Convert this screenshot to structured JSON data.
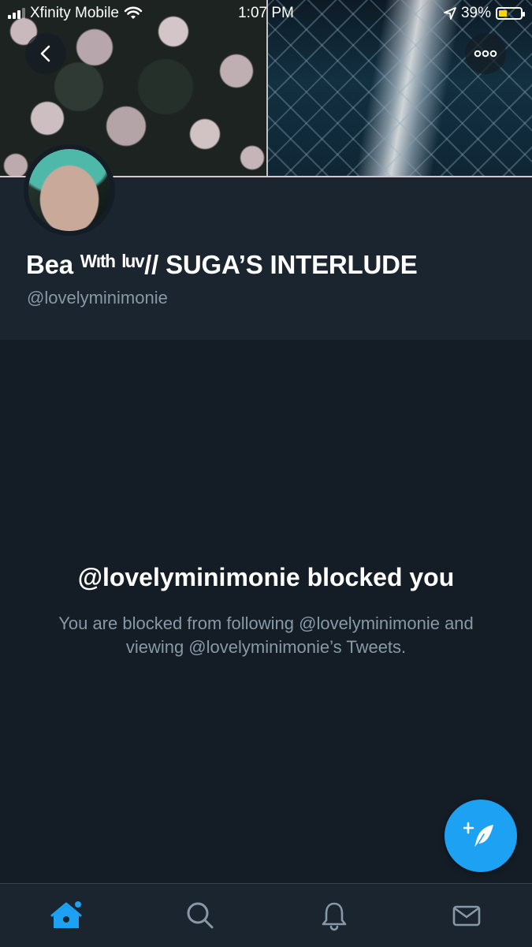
{
  "status_bar": {
    "carrier": "Xfinity Mobile",
    "time": "1:07 PM",
    "battery": "39%",
    "battery_level": 0.39
  },
  "profile": {
    "display_name": "Bea ᵂᶦᵗʰ ˡᵘᵛ// SUGA’S INTERLUDE",
    "handle": "@lovelyminimonie"
  },
  "blocked": {
    "title": "@lovelyminimonie blocked you",
    "description": "You are blocked from following @lovelyminimonie and viewing @lovelyminimonie’s Tweets."
  },
  "tabs": [
    {
      "name": "home-icon",
      "active": true
    },
    {
      "name": "search-icon",
      "active": false
    },
    {
      "name": "bell-icon",
      "active": false
    },
    {
      "name": "mail-icon",
      "active": false
    }
  ],
  "colors": {
    "background": "#141d26",
    "accent": "#1da1f2",
    "secondary_text": "#8899a6"
  }
}
